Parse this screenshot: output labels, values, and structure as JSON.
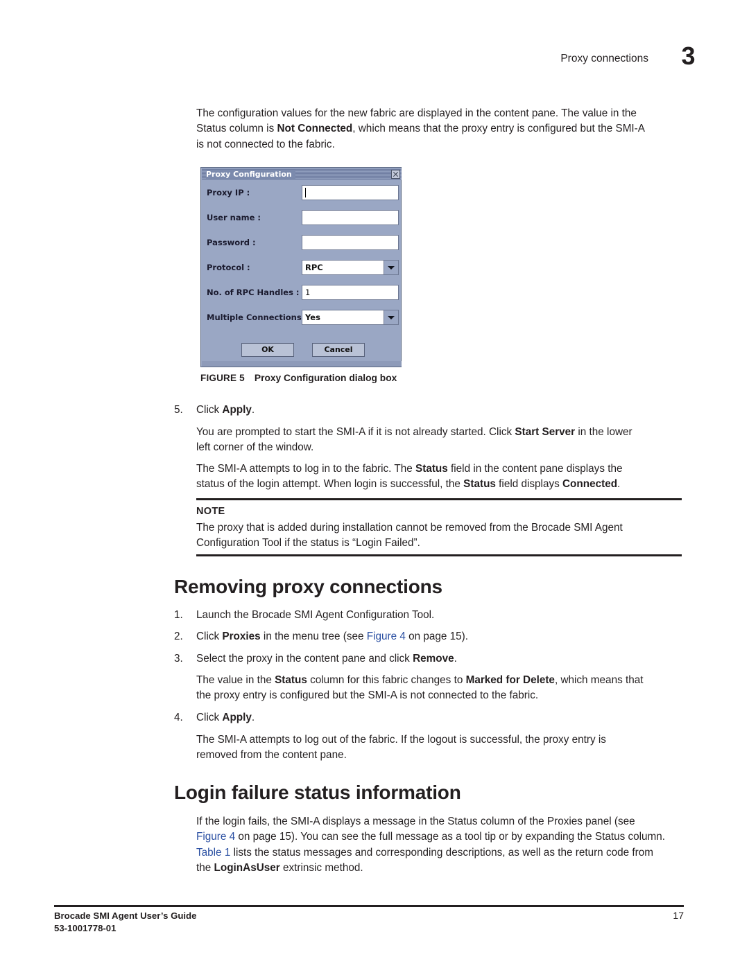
{
  "header": {
    "title": "Proxy connections",
    "chapter": "3"
  },
  "intro": {
    "line1": "The configuration values for the new fabric are displayed in the content pane. The value in the",
    "line2_a": "Status column is ",
    "line2_b": "Not Connected",
    "line2_c": ", which means that the proxy entry is configured but the SMI-A",
    "line3": "is not connected to the fabric."
  },
  "dialog": {
    "title": "Proxy Configuration",
    "close_icon": "close-icon",
    "fields": [
      {
        "label": "Proxy IP :",
        "value": "",
        "type": "text",
        "focused": true
      },
      {
        "label": "User name :",
        "value": "",
        "type": "text",
        "focused": false
      },
      {
        "label": "Password :",
        "value": "",
        "type": "text",
        "focused": false
      },
      {
        "label": "Protocol :",
        "value": "RPC",
        "type": "combo",
        "focused": false
      },
      {
        "label": "No. of RPC Handles :",
        "value": "1",
        "type": "text",
        "focused": false
      },
      {
        "label": "Multiple Connections",
        "value": "Yes",
        "type": "combo",
        "focused": false
      }
    ],
    "ok_label": "OK",
    "cancel_label": "Cancel"
  },
  "figure": {
    "number": "FIGURE 5",
    "title": "Proxy Configuration dialog box"
  },
  "steps_top": [
    {
      "num": "5.",
      "pre": "Click ",
      "bold": "Apply",
      "post": "."
    }
  ],
  "paras": {
    "p_startserver_1a": "You are prompted to start the SMI-A if it is not already started. Click ",
    "p_startserver_1b": "Start Server",
    "p_startserver_1c": " in the lower",
    "p_startserver_2": "left corner of the window.",
    "p_login_1a": "The SMI-A attempts to log in to the fabric. The ",
    "p_login_1b": "Status",
    "p_login_1c": " field in the content pane displays the",
    "p_login_2a": "status of the login attempt. When login is successful, the ",
    "p_login_2b": "Status",
    "p_login_2c": " field displays ",
    "p_login_2d": "Connected",
    "p_login_2e": "."
  },
  "note": {
    "label": "NOTE",
    "line1": "The proxy that is added during installation cannot be removed from the Brocade SMI Agent",
    "line2": "Configuration Tool if the status is “Login Failed”."
  },
  "section_removing": {
    "heading": "Removing proxy connections",
    "steps": [
      {
        "num": "1.",
        "text": "Launch the Brocade SMI Agent Configuration Tool."
      },
      {
        "num": "2.",
        "text": "Click Proxies in the menu tree (see Figure 4 on page 15)."
      },
      {
        "num": "3.",
        "text": "Select the proxy in the content pane and click Remove."
      },
      {
        "num": "4.",
        "text": "Click Apply."
      }
    ],
    "step2_parts": {
      "a": "Click ",
      "b": "Proxies",
      "c": " in the menu tree (see ",
      "link": "Figure 4",
      "d": " on page 15)."
    },
    "step3_parts": {
      "a": "Select the proxy in the content pane and click ",
      "b": "Remove",
      "c": "."
    },
    "step4_parts": {
      "a": "Click ",
      "b": "Apply",
      "c": "."
    },
    "p_marked_1a": "The value in the ",
    "p_marked_1b": "Status",
    "p_marked_1c": " column for this fabric changes to ",
    "p_marked_1d": "Marked for Delete",
    "p_marked_1e": ", which means that",
    "p_marked_2": "the proxy entry is configured but the SMI-A is not connected to the fabric.",
    "p_logout_1": "The SMI-A attempts to log out of the fabric. If the logout is successful, the proxy entry is",
    "p_logout_2": "removed from the content pane."
  },
  "section_login_failure": {
    "heading": "Login failure status information",
    "p1_l1": "If the login fails, the SMI-A displays a message in the Status column of the Proxies panel (see",
    "p1_l2_link": "Figure 4",
    "p1_l2_rest": " on page 15). You can see the full message as a tool tip or by expanding the Status column.",
    "p1_l3_link": "Table 1",
    "p1_l3_rest": " lists the status messages and corresponding descriptions, as well as the return code from",
    "p1_l4_a": "the ",
    "p1_l4_b": "LoginAsUser",
    "p1_l4_c": " extrinsic method."
  },
  "footer": {
    "guide": "Brocade SMI Agent User’s Guide",
    "docnum": "53-1001778-01",
    "page": "17"
  }
}
